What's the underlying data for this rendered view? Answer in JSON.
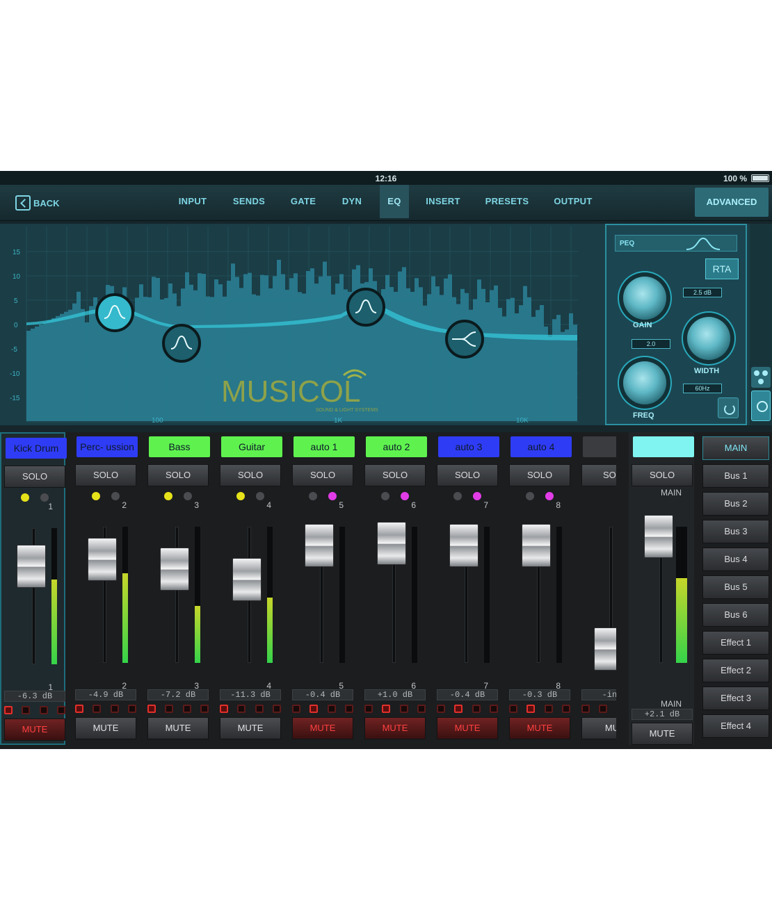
{
  "status": {
    "time": "12:16",
    "battery": "100 %"
  },
  "nav": {
    "back_label": "BACK",
    "tabs": [
      "INPUT",
      "SENDS",
      "GATE",
      "DYN",
      "EQ",
      "INSERT",
      "PRESETS",
      "OUTPUT"
    ],
    "active_tab": "EQ",
    "advanced_label": "ADVANCED"
  },
  "eq": {
    "y_ticks": [
      "15",
      "10",
      "5",
      "0",
      "-5",
      "-10",
      "-15"
    ],
    "x_ticks": [
      "100",
      "1K",
      "10K"
    ],
    "band_type": "PEQ",
    "rta_label": "RTA",
    "gain_label": "GAIN",
    "gain_value": "2.5 dB",
    "width_label": "WIDTH",
    "width_value": "2.0",
    "freq_label": "FREQ",
    "freq_value": "60Hz",
    "logo_text": "MUSICOL",
    "logo_sub": "SOUND & LIGHT SYSTEMS"
  },
  "channels": [
    {
      "name": "Kick Drum",
      "color": "#2f3cf5",
      "number": "1",
      "db": "-6.3 dB",
      "fader_level": 0.72,
      "meter": 0.62,
      "dots": [
        "yellow",
        "grey"
      ],
      "pads": [
        true,
        false,
        false,
        false
      ],
      "mute_on": true,
      "selected": true
    },
    {
      "name": "Perc- ussion",
      "color": "#2f3cf5",
      "number": "2",
      "db": "-4.9 dB",
      "fader_level": 0.76,
      "meter": 0.66,
      "dots": [
        "yellow",
        "grey"
      ],
      "pads": [
        true,
        false,
        false,
        false
      ],
      "mute_on": false
    },
    {
      "name": "Bass",
      "color": "#5ff24f",
      "number": "3",
      "db": "-7.2 dB",
      "fader_level": 0.69,
      "meter": 0.42,
      "dots": [
        "yellow",
        "grey"
      ],
      "pads": [
        true,
        false,
        false,
        false
      ],
      "mute_on": false
    },
    {
      "name": "Guitar",
      "color": "#5ff24f",
      "number": "4",
      "db": "-11.3 dB",
      "fader_level": 0.61,
      "meter": 0.48,
      "dots": [
        "yellow",
        "grey"
      ],
      "pads": [
        true,
        false,
        false,
        false
      ],
      "mute_on": false
    },
    {
      "name": "auto 1",
      "color": "#5ff24f",
      "number": "5",
      "db": "-0.4 dB",
      "fader_level": 0.86,
      "meter": 0.0,
      "dots": [
        "grey",
        "magenta"
      ],
      "pads": [
        false,
        true,
        false,
        false
      ],
      "mute_on": true
    },
    {
      "name": "auto 2",
      "color": "#5ff24f",
      "number": "6",
      "db": "+1.0 dB",
      "fader_level": 0.88,
      "meter": 0.0,
      "dots": [
        "grey",
        "magenta"
      ],
      "pads": [
        false,
        true,
        false,
        false
      ],
      "mute_on": true
    },
    {
      "name": "auto 3",
      "color": "#2f3cf5",
      "number": "7",
      "db": "-0.4 dB",
      "fader_level": 0.86,
      "meter": 0.0,
      "dots": [
        "grey",
        "magenta"
      ],
      "pads": [
        false,
        true,
        false,
        false
      ],
      "mute_on": true
    },
    {
      "name": "auto 4",
      "color": "#2f3cf5",
      "number": "8",
      "db": "-0.3 dB",
      "fader_level": 0.86,
      "meter": 0.0,
      "dots": [
        "grey",
        "magenta"
      ],
      "pads": [
        false,
        true,
        false,
        false
      ],
      "mute_on": true
    },
    {
      "name": "",
      "color": "#3a3c3f",
      "number": "",
      "db": "-inf",
      "fader_level": 0.1,
      "meter": 0.0,
      "dots": [],
      "pads": [
        false,
        false,
        false,
        false
      ],
      "mute_on": false,
      "solo": "SOL",
      "mute": "MU"
    }
  ],
  "solo_label": "SOLO",
  "mute_label": "MUTE",
  "main": {
    "name": "",
    "label_top": "MAIN",
    "label_bottom": "MAIN",
    "db": "+2.1 dB",
    "fader_level": 0.93,
    "meter": 0.62
  },
  "buses": [
    "MAIN",
    "Bus 1",
    "Bus 2",
    "Bus 3",
    "Bus 4",
    "Bus 5",
    "Bus 6",
    "Effect 1",
    "Effect 2",
    "Effect 3",
    "Effect 4"
  ],
  "active_bus": "MAIN",
  "colors": {
    "accent": "#7fd6e4",
    "eq_fill": "#2a7d92",
    "eq_bg": "#1a3d46",
    "mute_red": "#ff4040"
  }
}
